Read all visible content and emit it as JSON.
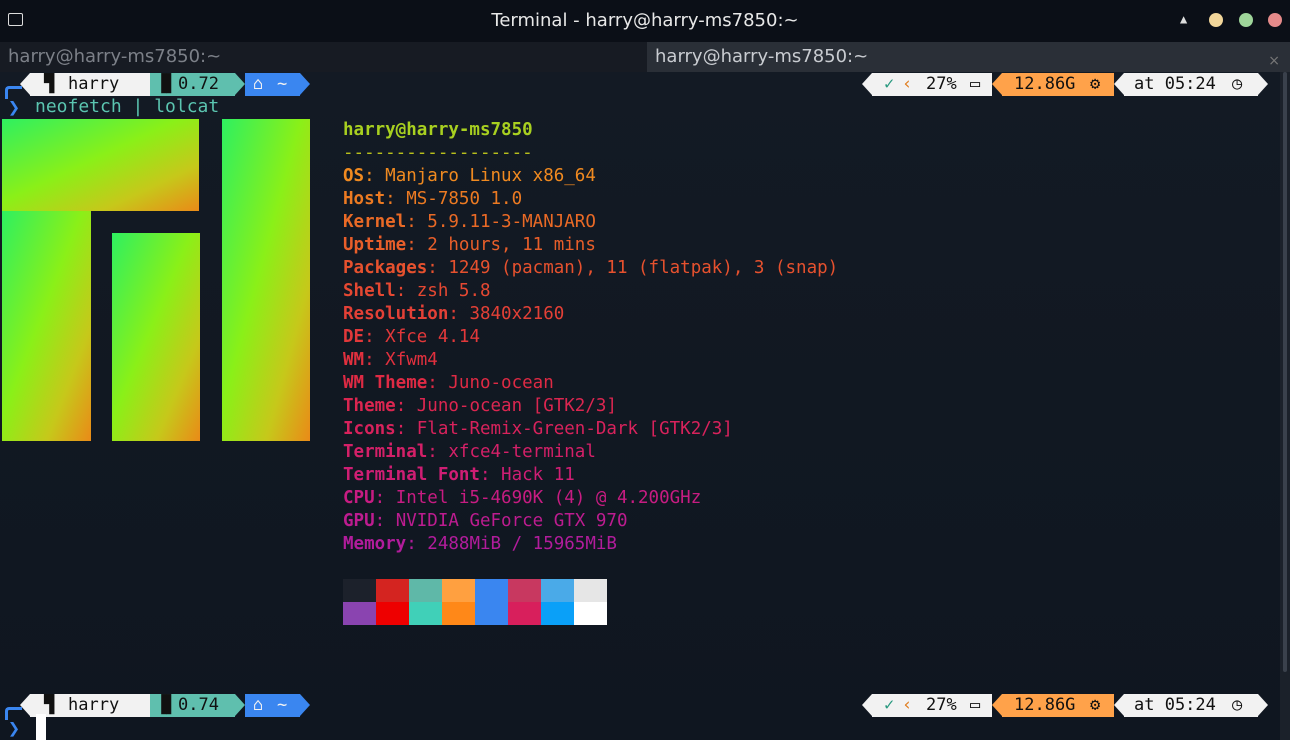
{
  "window": {
    "title": "Terminal - harry@harry-ms7850:~",
    "tabs": [
      {
        "label": "harry@harry-ms7850:~",
        "active": false
      },
      {
        "label": "harry@harry-ms7850:~",
        "active": true
      }
    ],
    "close_glyph": "×"
  },
  "prompts": [
    {
      "user": "harry",
      "load": "0.72",
      "dir": "~",
      "status": "✓",
      "cpu": "27%",
      "mem": "12.86G",
      "time": "at 05:24",
      "command": "neofetch | lolcat"
    },
    {
      "user": "harry",
      "load": "0.74",
      "dir": "~",
      "status": "✓",
      "cpu": "27%",
      "mem": "12.86G",
      "time": "at 05:24",
      "command": ""
    }
  ],
  "neofetch": {
    "header": "harry@harry-ms7850",
    "separator": "------------------",
    "rows": [
      {
        "key": "OS",
        "value": "Manjaro Linux x86_64"
      },
      {
        "key": "Host",
        "value": "MS-7850 1.0"
      },
      {
        "key": "Kernel",
        "value": "5.9.11-3-MANJARO"
      },
      {
        "key": "Uptime",
        "value": "2 hours, 11 mins"
      },
      {
        "key": "Packages",
        "value": "1249 (pacman), 11 (flatpak), 3 (snap)"
      },
      {
        "key": "Shell",
        "value": "zsh 5.8"
      },
      {
        "key": "Resolution",
        "value": "3840x2160"
      },
      {
        "key": "DE",
        "value": "Xfce 4.14"
      },
      {
        "key": "WM",
        "value": "Xfwm4"
      },
      {
        "key": "WM Theme",
        "value": "Juno-ocean"
      },
      {
        "key": "Theme",
        "value": "Juno-ocean [GTK2/3]"
      },
      {
        "key": "Icons",
        "value": "Flat-Remix-Green-Dark [GTK2/3]"
      },
      {
        "key": "Terminal",
        "value": "xfce4-terminal"
      },
      {
        "key": "Terminal Font",
        "value": "Hack 11"
      },
      {
        "key": "CPU",
        "value": "Intel i5-4690K (4) @ 4.200GHz"
      },
      {
        "key": "GPU",
        "value": "NVIDIA GeForce GTX 970"
      },
      {
        "key": "Memory",
        "value": "2488MiB / 15965MiB"
      }
    ],
    "row_colors": [
      "#f08a20",
      "#ec7a22",
      "#ea6a26",
      "#e85e2a",
      "#e6512e",
      "#e54832",
      "#e44036",
      "#e2383a",
      "#e0303e",
      "#de2a44",
      "#db2650",
      "#d8225c",
      "#d42068",
      "#cf1e74",
      "#c71c82",
      "#bd1c90",
      "#b21c9c"
    ],
    "header_color": "#a8d020",
    "separator_color": "#b8c01c",
    "palette_top": [
      "#1c212b",
      "#d42420",
      "#5fb8a8",
      "#ffa040",
      "#3a86f0",
      "#c83860",
      "#4aaae8",
      "#e6e6e6"
    ],
    "palette_bottom": [
      "#8a44b0",
      "#ee0000",
      "#40d0b8",
      "#ff8818",
      "#3a86f0",
      "#d81f5c",
      "#0aa0f8",
      "#ffffff"
    ]
  },
  "colors": {
    "seg_user": "#f2f2f2",
    "seg_load": "#5fbfae",
    "seg_dir": "#3a86f0",
    "seg_status": "#f2f2f2",
    "seg_mem": "#ffa24a",
    "seg_time": "#f2f2f2",
    "cmd": "#5bc5b0",
    "prompt_arrow": "#3a86f0"
  }
}
